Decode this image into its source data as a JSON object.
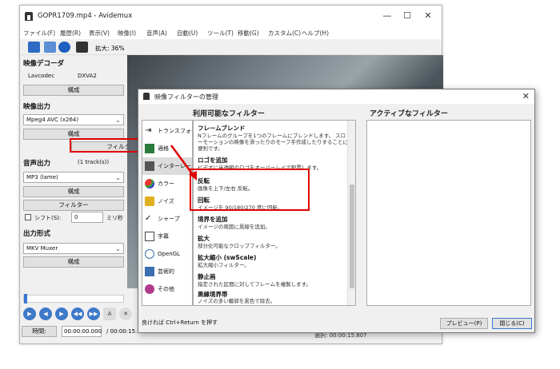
{
  "window": {
    "title": "GOPR1709.mp4 - Avidemux",
    "controls": {
      "minimize": "—",
      "maximize": "☐",
      "close": "✕"
    }
  },
  "menu": [
    "ファイル(F)",
    "履歴(R)",
    "表示(V)",
    "映像(I)",
    "音声(A)",
    "自動(U)",
    "ツール(T)",
    "移動(G)",
    "カスタム(C)",
    "ヘルプ(H)"
  ],
  "toolbar": {
    "zoom_label": "拡大: 36%"
  },
  "video_decoder": {
    "title": "映像デコーダ",
    "codec_label": "Lavcodec",
    "codec_value": "DXVA2",
    "config_button": "構成"
  },
  "video_output": {
    "title": "映像出力",
    "codec_selected": "Mpeg4 AVC (x264)",
    "config_button": "構成",
    "filter_button": "フィルター"
  },
  "audio_output": {
    "title": "音声出力",
    "tracks": "(1 track(s))",
    "codec_selected": "MP3 (lame)",
    "config_button": "構成",
    "filter_button": "フィルター",
    "shift_label": "シフト(S):",
    "shift_value": "0",
    "shift_unit": "ミリ秒"
  },
  "output_format": {
    "title": "出力形式",
    "format_selected": "MKV Muxer",
    "config_button": "構成"
  },
  "playback": {
    "time_button": "時間:",
    "time_value": "00:00:00.000",
    "time_total": "/ 00:00:15.",
    "selection_label": "選択: 00:00:15.807"
  },
  "dialog": {
    "title": "映像フィルターの管理",
    "close": "✕",
    "available_header": "利用可能なフィルター",
    "active_header": "アクティブなフィルター",
    "categories": [
      {
        "label": "トランスフォーム",
        "icon": "transform-icon",
        "color": "#444444"
      },
      {
        "label": "適格",
        "icon": "interlace-icon",
        "color": "#2a7a3a"
      },
      {
        "label": "インターレース",
        "icon": "interlace-film-icon",
        "color": "#555555"
      },
      {
        "label": "カラー",
        "icon": "color-icon",
        "color": "#d33a2c"
      },
      {
        "label": "ノイズ",
        "icon": "noise-icon",
        "color": "#e0b020"
      },
      {
        "label": "シャープ",
        "icon": "sharpen-icon",
        "color": "#222222"
      },
      {
        "label": "字幕",
        "icon": "subtitle-icon",
        "color": "#444444"
      },
      {
        "label": "OpenGL",
        "icon": "opengl-icon",
        "color": "#3a6fb0"
      },
      {
        "label": "芸術的",
        "icon": "artistic-icon",
        "color": "#3a6fb0"
      },
      {
        "label": "その他",
        "icon": "misc-icon",
        "color": "#b03a8a"
      }
    ],
    "filters": [
      {
        "name": "フレームブレンド",
        "desc": "Nフレームのグループを1つのフレームにブレンドします。 スローモーションの映像を滑ったりのモーフ手作成したりすることに便利です。"
      },
      {
        "name": "ロゴを追加",
        "desc": "ビデオに半透明のロゴをオーバーレイで配置します。"
      },
      {
        "name": "反転",
        "desc": "画像を上下/左右 反転。"
      },
      {
        "name": "回転",
        "desc": "イメージを 90/180/270 度に回転。"
      },
      {
        "name": "境界を追加",
        "desc": "イメージの周囲に黒線を追加。"
      },
      {
        "name": "拡大",
        "desc": "部分化可能なクロップフィルター。"
      },
      {
        "name": "拡大縮小 (swScale)",
        "desc": "拡大縮小フィルター。"
      },
      {
        "name": "静止画",
        "desc": "指定された区間に対してフレームを複製します。"
      },
      {
        "name": "黒縁境界帯",
        "desc": "ノイズの多い輪郭を黒色で除去。"
      }
    ],
    "hint": "良ければ Ctrl+Return を押す",
    "preview_button": "プレビュー(P)",
    "close_button": "閉じる(C)"
  },
  "colors": {
    "highlight": "#e00000",
    "accent": "#3a77d4"
  }
}
